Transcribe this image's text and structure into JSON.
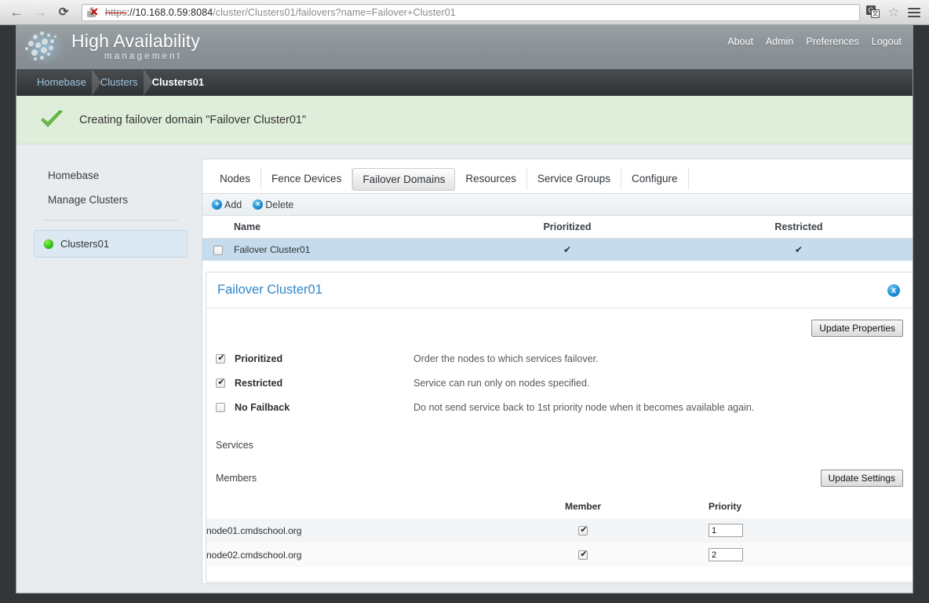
{
  "browser": {
    "back_icon": "back-arrow-icon",
    "forward_icon": "forward-arrow-icon",
    "reload_icon": "reload-icon",
    "url_scheme": "https",
    "url_host": "://10.168.0.59:8084",
    "url_path": "/cluster/Clusters01/failovers?name=Failover+Cluster01",
    "url_full": "https://10.168.0.59:8084/cluster/Clusters01/failovers?name=Failover+Cluster01",
    "translate_icon_a": "G",
    "translate_icon_b": "文",
    "star_icon": "☆",
    "menu_icon": "hamburger-menu-icon"
  },
  "header": {
    "title": "High Availability",
    "subtitle": "management",
    "nav": [
      {
        "label": "About"
      },
      {
        "label": "Admin"
      },
      {
        "label": "Preferences"
      },
      {
        "label": "Logout"
      }
    ]
  },
  "breadcrumb": [
    {
      "label": "Homebase",
      "current": false
    },
    {
      "label": "Clusters",
      "current": false
    },
    {
      "label": "Clusters01",
      "current": true
    }
  ],
  "notice": {
    "icon": "green-check-icon",
    "message": "Creating failover domain \"Failover Cluster01\""
  },
  "sidebar": {
    "links": [
      {
        "label": "Homebase"
      },
      {
        "label": "Manage Clusters"
      }
    ],
    "cluster": {
      "label": "Clusters01",
      "status_color": "#3ecb17"
    }
  },
  "tabs": [
    {
      "label": "Nodes",
      "active": false
    },
    {
      "label": "Fence Devices",
      "active": false
    },
    {
      "label": "Failover Domains",
      "active": true
    },
    {
      "label": "Resources",
      "active": false
    },
    {
      "label": "Service Groups",
      "active": false
    },
    {
      "label": "Configure",
      "active": false
    }
  ],
  "toolbar": {
    "add_label": "Add",
    "add_glyph": "+",
    "delete_label": "Delete",
    "delete_glyph": "×"
  },
  "grid": {
    "columns": [
      "Name",
      "Prioritized",
      "Restricted"
    ],
    "rows": [
      {
        "selected": false,
        "name": "Failover Cluster01",
        "prioritized": "✔",
        "restricted": "✔"
      }
    ]
  },
  "detail": {
    "title": "Failover Cluster01",
    "close_glyph": "x",
    "update_properties_label": "Update Properties",
    "options": [
      {
        "label": "Prioritized",
        "checked": true,
        "description": "Order the nodes to which services failover."
      },
      {
        "label": "Restricted",
        "checked": true,
        "description": "Service can run only on nodes specified."
      },
      {
        "label": "No Failback",
        "checked": false,
        "description": "Do not send service back to 1st priority node when it becomes available again."
      }
    ],
    "services_label": "Services",
    "members_label": "Members",
    "update_settings_label": "Update Settings",
    "members_columns": [
      "",
      "Member",
      "Priority"
    ],
    "members": [
      {
        "name": "node01.cmdschool.org",
        "member_checked": true,
        "priority": "1"
      },
      {
        "name": "node02.cmdschool.org",
        "member_checked": true,
        "priority": "2"
      }
    ]
  },
  "colors": {
    "accent_blue": "#2e87cd",
    "notice_green_bg": "#dfeeda",
    "row_selected_blue": "#c6dced",
    "header_gray": "#8d9499",
    "page_bg": "#333638"
  }
}
